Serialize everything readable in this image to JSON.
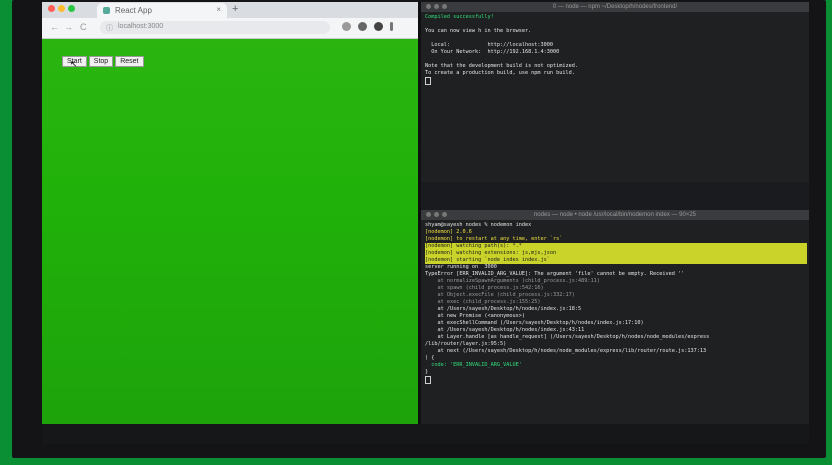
{
  "browser": {
    "tab_title": "React App",
    "tab_close": "×",
    "new_tab": "+",
    "url": "localhost:3000",
    "back": "←",
    "forward": "→",
    "reload": "C",
    "info": "ⓘ",
    "buttons": [
      "Start",
      "Stop",
      "Reset"
    ]
  },
  "terminal_top": {
    "title": "0 — node — npm ~/Desktop/h/nodes/frontend/",
    "lines": [
      {
        "text": "Compiled successfully!",
        "style": "c-green"
      },
      {
        "text": "",
        "style": "c-white"
      },
      {
        "text": "You can now view h in the browser.",
        "style": "c-white"
      },
      {
        "text": "",
        "style": "c-white"
      },
      {
        "text": "  Local:            http://localhost:3000",
        "style": "c-white"
      },
      {
        "text": "  On Your Network:  http://192.168.1.4:3000",
        "style": "c-white"
      },
      {
        "text": "",
        "style": "c-white"
      },
      {
        "text": "Note that the development build is not optimized.",
        "style": "c-white"
      },
      {
        "text": "To create a production build, use npm run build.",
        "style": "c-white"
      }
    ]
  },
  "terminal_bottom": {
    "title": "nodes — node • node /usr/local/bin/nodemon index — 90×25",
    "lines": [
      {
        "text": "shyam@sayesh nodes % nodemon index",
        "style": "c-white"
      },
      {
        "text": "[nodemon] 2.0.6",
        "style": "c-yellow"
      },
      {
        "text": "[nodemon] to restart at any time, enter `rs`",
        "style": "c-yellow"
      },
      {
        "text": "[nodemon] watching path(s): *.*",
        "style": "c-hl"
      },
      {
        "text": "[nodemon] watching extensions: js,mjs,json",
        "style": "c-hl"
      },
      {
        "text": "[nodemon] starting `node index index.js`",
        "style": "c-hl"
      },
      {
        "text": "server running on  3000",
        "style": "c-white"
      },
      {
        "text": "TypeError [ERR_INVALID_ARG_VALUE]: The argument 'file' cannot be empty. Received ''",
        "style": "c-white"
      },
      {
        "text": "    at normalizeSpawnArguments (child_process.js:489:11)",
        "style": "c-dim"
      },
      {
        "text": "    at spawn (child_process.js:542:16)",
        "style": "c-dim"
      },
      {
        "text": "    at Object.execFile (child_process.js:332:17)",
        "style": "c-dim"
      },
      {
        "text": "    at exec (child_process.js:155:25)",
        "style": "c-dim"
      },
      {
        "text": "    at /Users/sayesh/Desktop/h/nodes/index.js:18:5",
        "style": "c-white"
      },
      {
        "text": "    at new Promise (<anonymous>)",
        "style": "c-white"
      },
      {
        "text": "    at execShellCommand (/Users/sayesh/Desktop/h/nodes/index.js:17:10)",
        "style": "c-white"
      },
      {
        "text": "    at /Users/sayesh/Desktop/h/nodes/index.js:43:11",
        "style": "c-white"
      },
      {
        "text": "    at Layer.handle [as handle_request] (/Users/sayesh/Desktop/h/nodes/node_modules/express",
        "style": "c-white"
      },
      {
        "text": "/lib/router/layer.js:95:5)",
        "style": "c-white"
      },
      {
        "text": "    at next (/Users/sayesh/Desktop/h/nodes/node_modules/express/lib/router/route.js:137:13",
        "style": "c-white"
      },
      {
        "text": ") {",
        "style": "c-white"
      },
      {
        "text": "  code: 'ERR_INVALID_ARG_VALUE'",
        "style": "c-green"
      },
      {
        "text": "}",
        "style": "c-white"
      }
    ]
  }
}
